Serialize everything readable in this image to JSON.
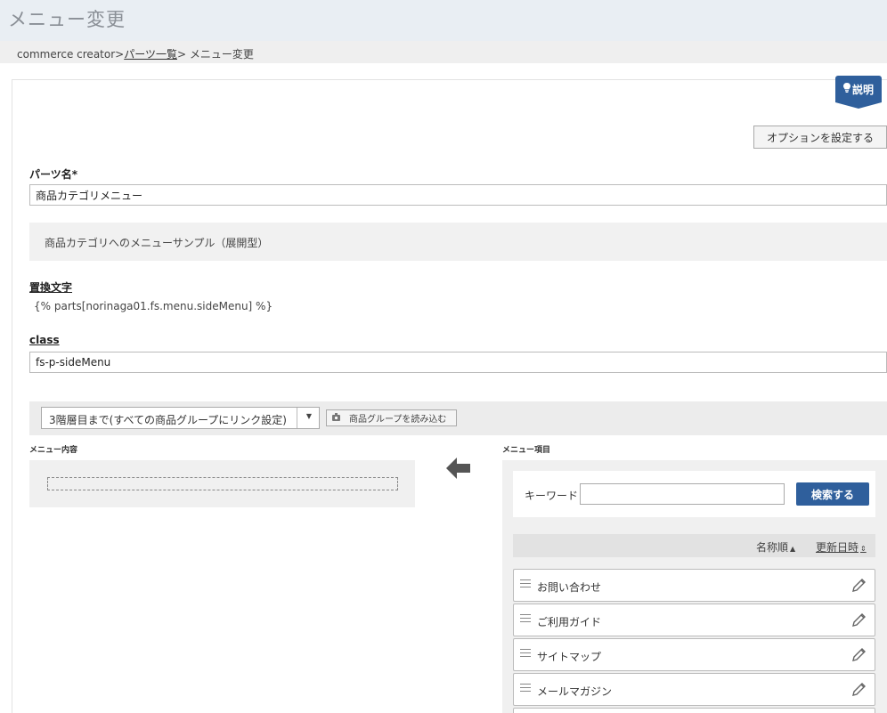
{
  "page": {
    "title": "メニュー変更"
  },
  "breadcrumb": {
    "root": "commerce creator>",
    "parts_list": "パーツ一覧",
    "current": "> メニュー変更"
  },
  "help": {
    "label": "説明",
    "icon": "lightbulb-icon"
  },
  "option_button": "オプションを設定する",
  "part_name": {
    "label": "パーツ名*",
    "value": "商品カテゴリメニュー"
  },
  "description": "商品カテゴリへのメニューサンプル（展開型）",
  "replace": {
    "label": "置換文字",
    "value": "{% parts[norinaga01.fs.menu.sideMenu] %}"
  },
  "class_field": {
    "label": "class",
    "value": "fs-p-sideMenu"
  },
  "toolbar": {
    "depth_select": "3階層目まで(すべての商品グループにリンク設定)",
    "load_button": "商品グループを読み込む"
  },
  "menu_content": {
    "heading": "メニュー内容"
  },
  "menu_items": {
    "heading": "メニュー項目",
    "keyword_label": "キーワード",
    "keyword_value": "",
    "search_button": "検索する",
    "sort_name": "名称順",
    "sort_updated": "更新日時",
    "items": [
      {
        "label": "お問い合わせ"
      },
      {
        "label": "ご利用ガイド"
      },
      {
        "label": "サイトマップ"
      },
      {
        "label": "メールマガジン"
      },
      {
        "label": ""
      }
    ]
  },
  "colors": {
    "accent": "#2f5f9c",
    "topbar": "#e9eef3"
  }
}
